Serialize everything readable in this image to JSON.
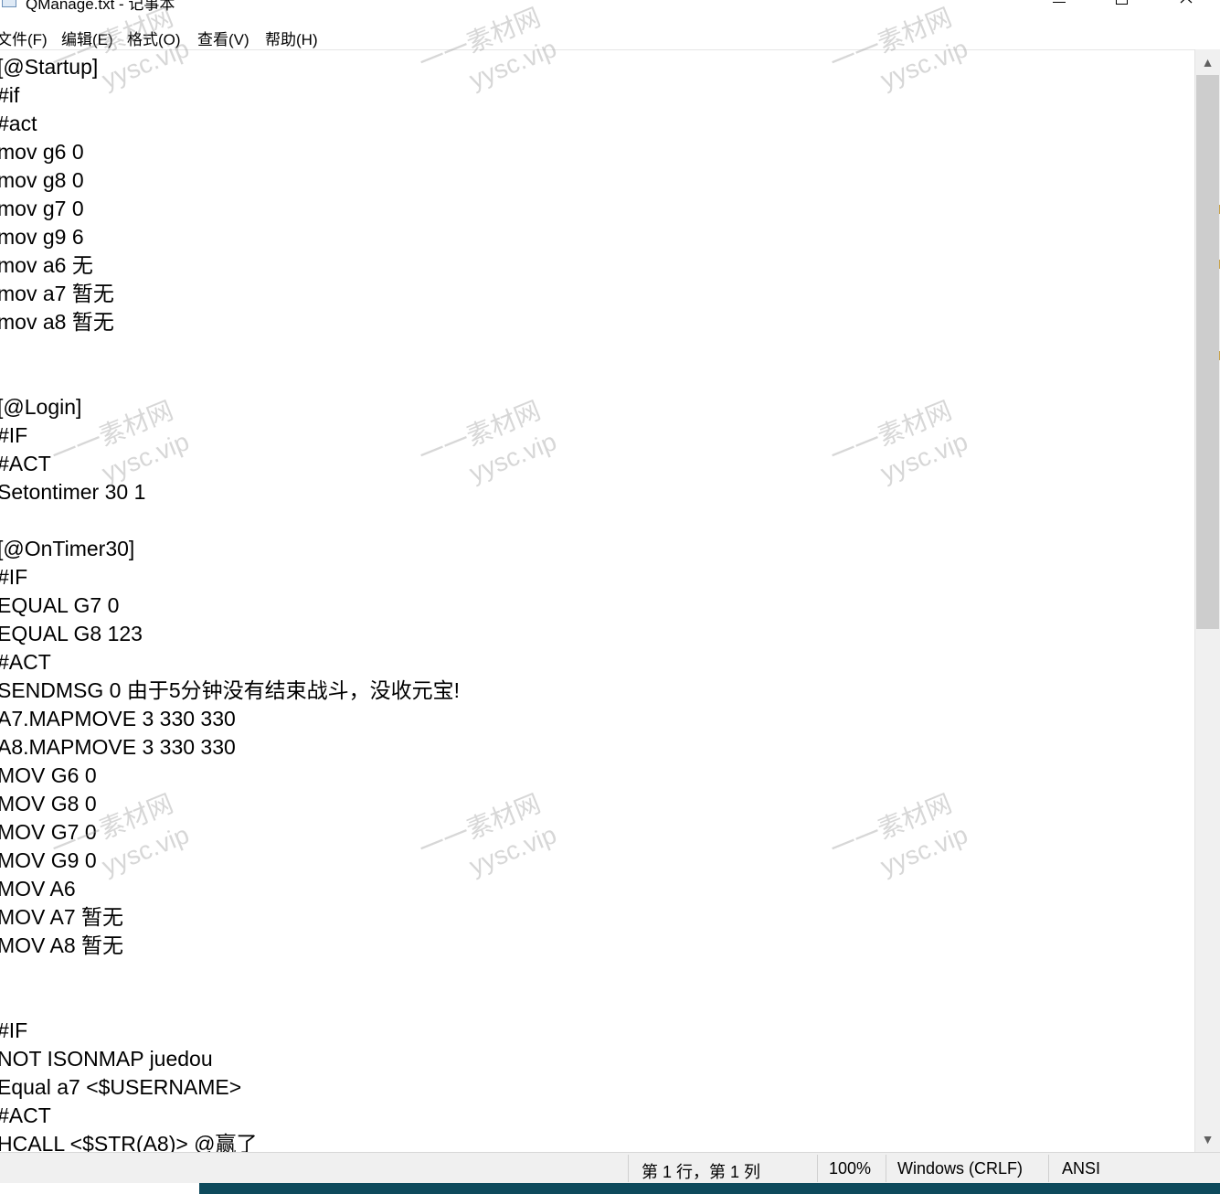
{
  "window": {
    "title": "QManage.txt - 记事本",
    "controls": {
      "minimize": "minimize-icon",
      "maximize": "maximize-icon",
      "close": "close-icon"
    }
  },
  "menu": {
    "items": [
      "文件(F)",
      "编辑(E)",
      "格式(O)",
      "查看(V)",
      "帮助(H)"
    ]
  },
  "editor": {
    "lines": [
      "[@Startup]",
      "#if",
      "#act",
      "mov g6 0",
      "mov g8 0",
      "mov g7 0",
      "mov g9 6",
      "mov a6 无",
      "mov a7 暂无",
      "mov a8 暂无",
      "",
      "",
      "[@Login]",
      "#IF",
      "#ACT",
      "Setontimer 30 1",
      "",
      "[@OnTimer30]",
      "#IF",
      "EQUAL G7 0",
      "EQUAL G8 123",
      "#ACT",
      "SENDMSG 0 由于5分钟没有结束战斗，没收元宝!",
      "A7.MAPMOVE 3 330 330",
      "A8.MAPMOVE 3 330 330",
      "MOV G6 0",
      "MOV G8 0",
      "MOV G7 0",
      "MOV G9 0",
      "MOV A6",
      "MOV A7 暂无",
      "MOV A8 暂无",
      "",
      "",
      "#IF",
      "NOT ISONMAP juedou",
      "Equal a7 <$USERNAME>",
      "#ACT",
      "HCALL <$STR(A8)> @赢了"
    ]
  },
  "scrollbar": {
    "up_icon": "▲",
    "down_icon": "▼"
  },
  "status": {
    "position": "第 1 行，第 1 列",
    "zoom": "100%",
    "line_ending": "Windows (CRLF)",
    "encoding": "ANSI"
  },
  "watermark": {
    "cn": "一一素材网",
    "en": "yysc.vip"
  }
}
